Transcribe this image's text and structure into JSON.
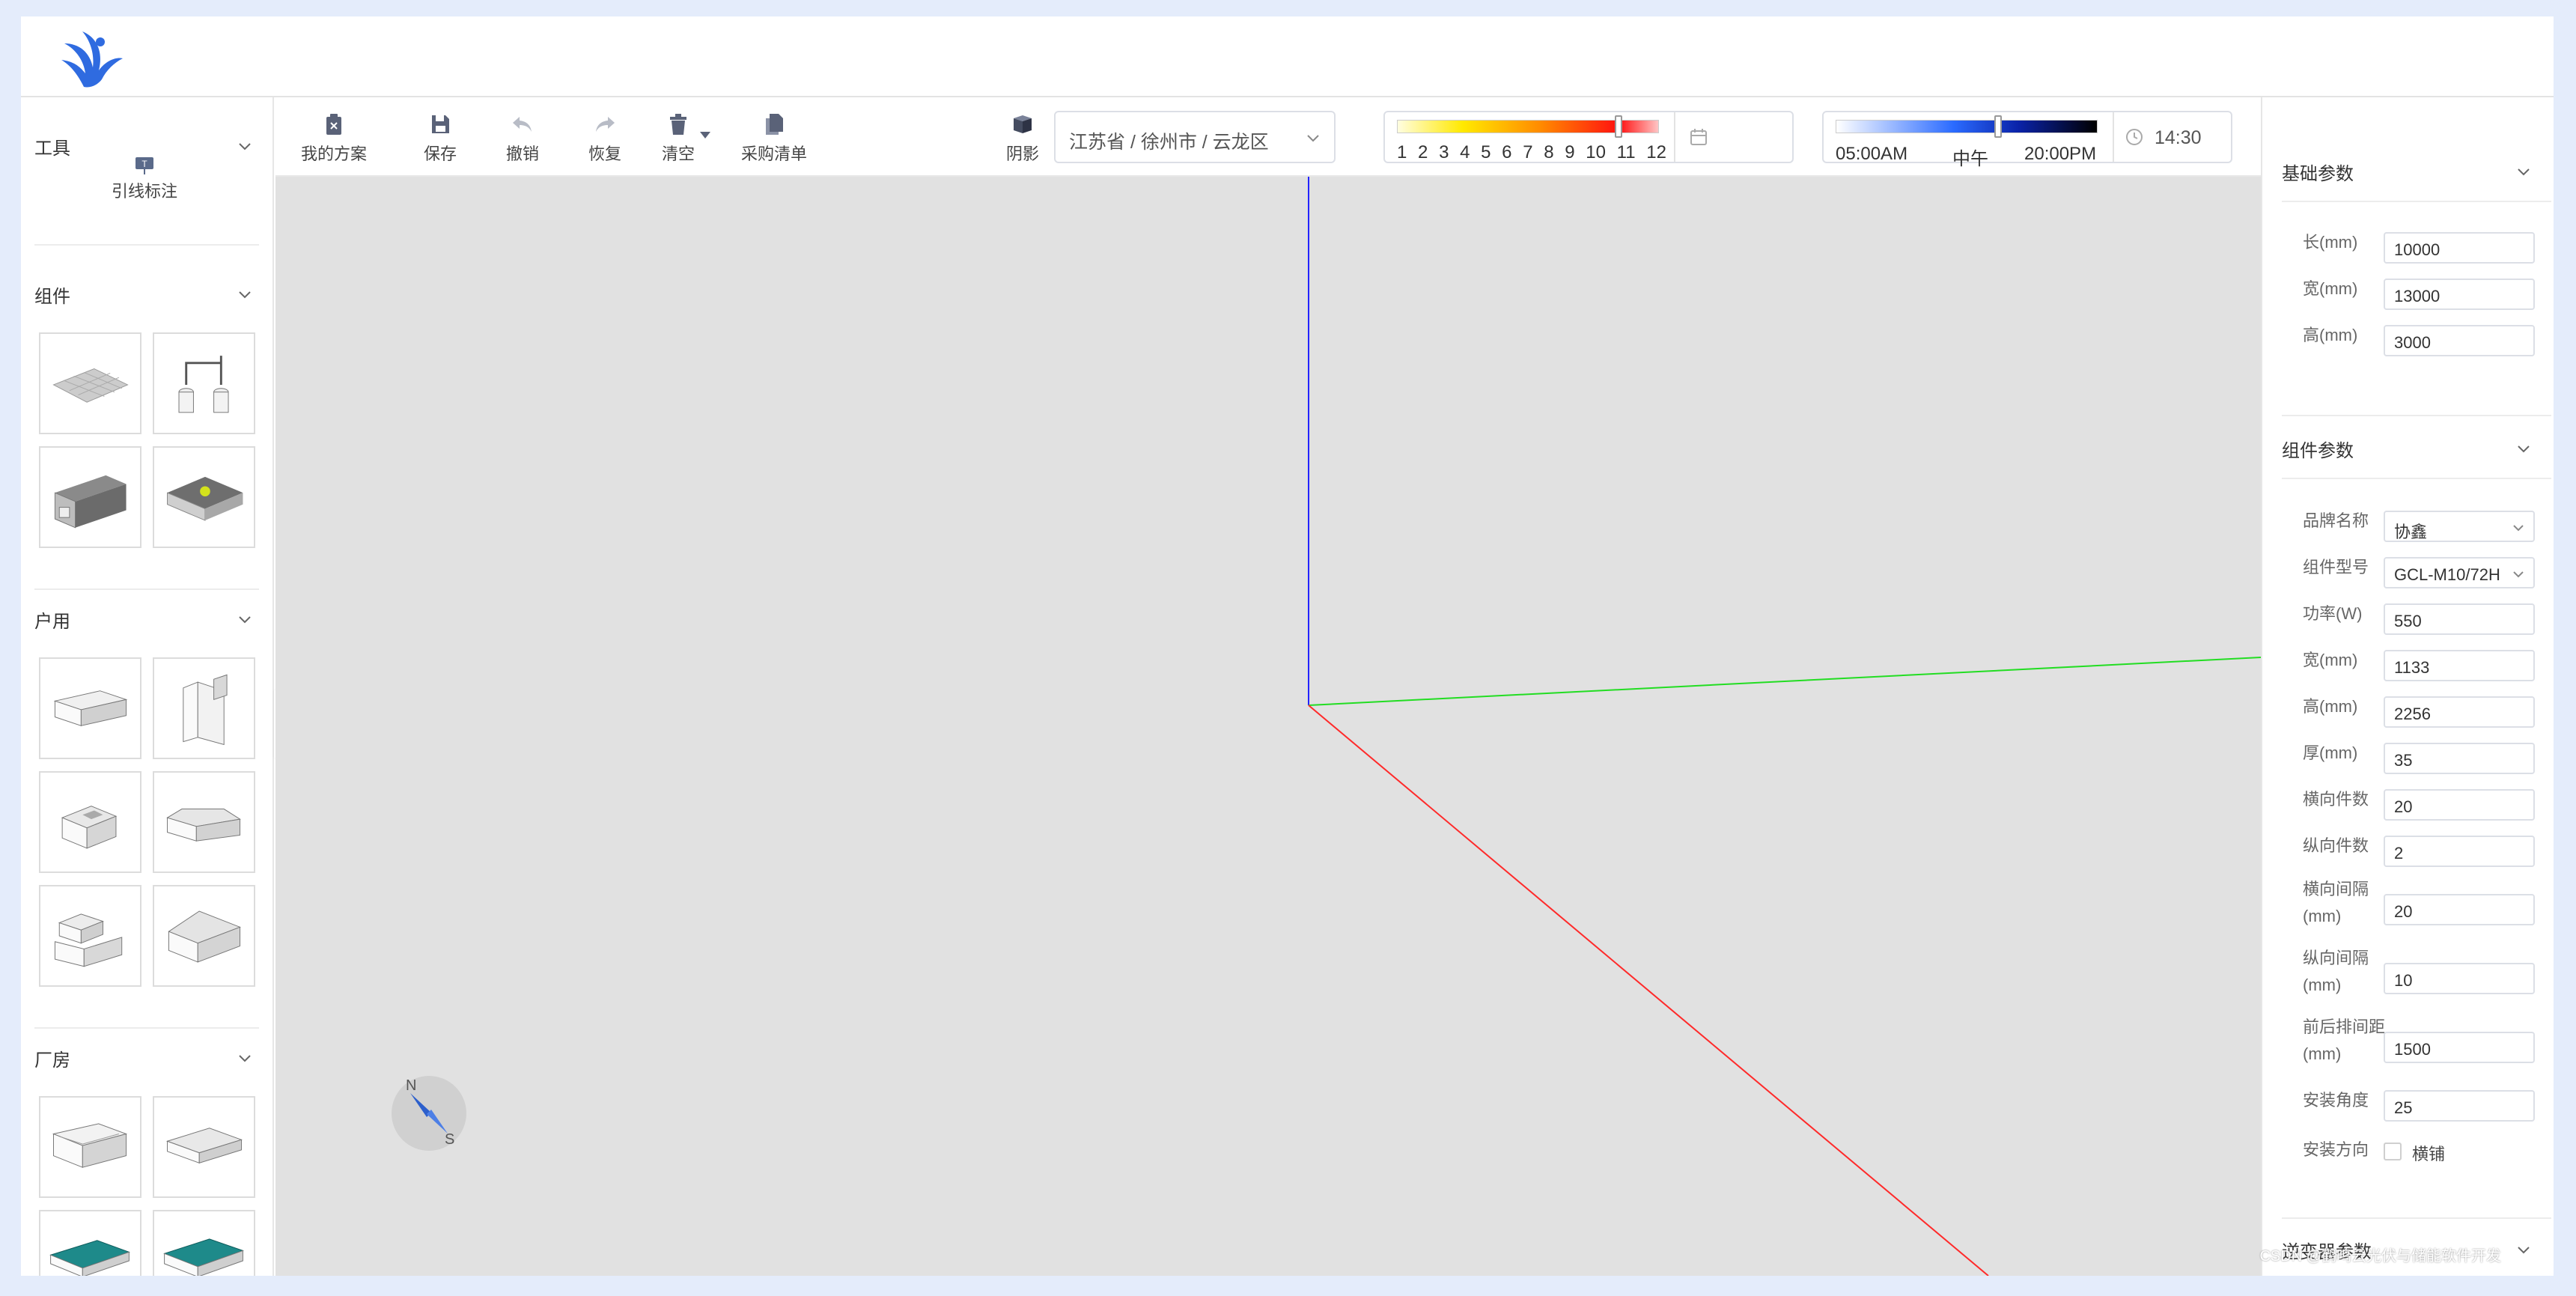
{
  "left_panel": {
    "sections": [
      {
        "title": "工具",
        "tool_label": "引线标注"
      },
      {
        "title": "组件"
      },
      {
        "title": "户用"
      },
      {
        "title": "厂房"
      }
    ]
  },
  "toolbar": {
    "my_plans": "我的方案",
    "save": "保存",
    "undo": "撤销",
    "redo": "恢复",
    "clear": "清空",
    "purchase_list": "采购清单",
    "shadow": "阴影",
    "location": "江苏省 / 徐州市 / 云龙区",
    "months": [
      "1",
      "2",
      "3",
      "4",
      "5",
      "6",
      "7",
      "8",
      "9",
      "10",
      "11",
      "12"
    ],
    "month_value": 11,
    "time_labels": {
      "start": "05:00AM",
      "mid": "中午",
      "end": "20:00PM"
    },
    "time_value": "14:30",
    "time_position": 0.62
  },
  "right_panel": {
    "basic": {
      "title": "基础参数",
      "fields": [
        {
          "label": "长(mm)",
          "value": "10000"
        },
        {
          "label": "宽(mm)",
          "value": "13000"
        },
        {
          "label": "高(mm)",
          "value": "3000"
        }
      ]
    },
    "module": {
      "title": "组件参数",
      "brand_label": "品牌名称",
      "brand_value": "协鑫",
      "model_label": "组件型号",
      "model_value": "GCL-M10/72H",
      "fields": [
        {
          "label": "功率(W)",
          "value": "550"
        },
        {
          "label": "宽(mm)",
          "value": "1133"
        },
        {
          "label": "高(mm)",
          "value": "2256"
        },
        {
          "label": "厚(mm)",
          "value": "35"
        },
        {
          "label": "横向件数",
          "value": "20"
        },
        {
          "label": "纵向件数",
          "value": "2"
        }
      ],
      "h_gap_label": "横向间隔",
      "h_gap_unit": "(mm)",
      "h_gap_value": "20",
      "v_gap_label": "纵向间隔",
      "v_gap_unit": "(mm)",
      "v_gap_value": "10",
      "row_dist_label": "前后排间距",
      "row_dist_unit": "(mm)",
      "row_dist_value": "1500",
      "angle_label": "安装角度",
      "angle_value": "25",
      "direction_label": "安装方向",
      "direction_option": "横铺"
    },
    "inverter": {
      "title": "逆变器参数"
    }
  },
  "compass": {
    "n": "N",
    "s": "S"
  },
  "watermark": "CSDN @鹤鸣云光伏与储能软件开发",
  "colors": {
    "accent": "#4a6fd0",
    "axis_x": "#ff2a2a",
    "axis_y": "#22dd22",
    "axis_z": "#2222ff",
    "canvas": "#e1e1e1"
  }
}
